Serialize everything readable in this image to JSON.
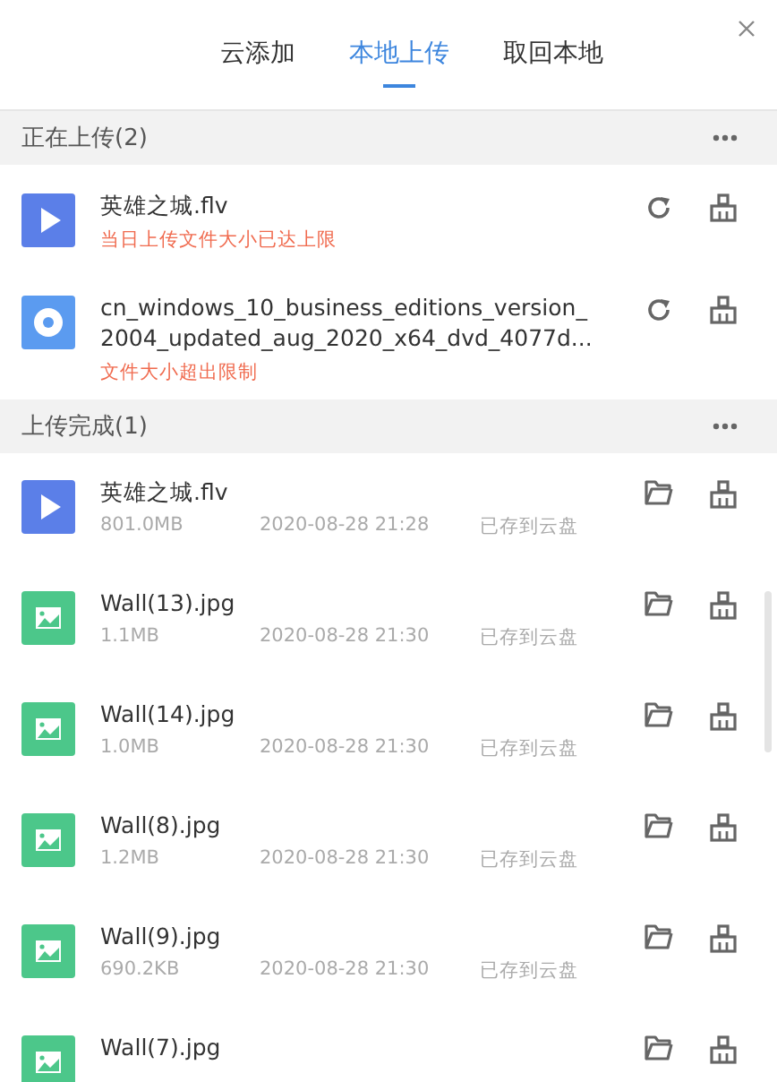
{
  "tabs": [
    {
      "label": "云添加",
      "selected": false
    },
    {
      "label": "本地上传",
      "selected": true
    },
    {
      "label": "取回本地",
      "selected": false
    }
  ],
  "sections": [
    {
      "title": "正在上传(2)",
      "kind": "uploading",
      "items": [
        {
          "kind": "video",
          "name": "英雄之城.flv",
          "error": "当日上传文件大小已达上限"
        },
        {
          "kind": "disc",
          "name": "cn_windows_10_business_editions_version_2004_updated_aug_2020_x64_dvd_4077d...",
          "error": "文件大小超出限制"
        }
      ]
    },
    {
      "title": "上传完成(1)",
      "kind": "done",
      "items": [
        {
          "kind": "video",
          "name": "英雄之城.flv",
          "size": "801.0MB",
          "time": "2020-08-28 21:28",
          "status": "已存到云盘"
        },
        {
          "kind": "image",
          "name": "Wall(13).jpg",
          "size": "1.1MB",
          "time": "2020-08-28 21:30",
          "status": "已存到云盘"
        },
        {
          "kind": "image",
          "name": "Wall(14).jpg",
          "size": "1.0MB",
          "time": "2020-08-28 21:30",
          "status": "已存到云盘"
        },
        {
          "kind": "image",
          "name": "Wall(8).jpg",
          "size": "1.2MB",
          "time": "2020-08-28 21:30",
          "status": "已存到云盘"
        },
        {
          "kind": "image",
          "name": "Wall(9).jpg",
          "size": "690.2KB",
          "time": "2020-08-28 21:30",
          "status": "已存到云盘"
        },
        {
          "kind": "image",
          "name": "Wall(7).jpg"
        }
      ]
    }
  ]
}
